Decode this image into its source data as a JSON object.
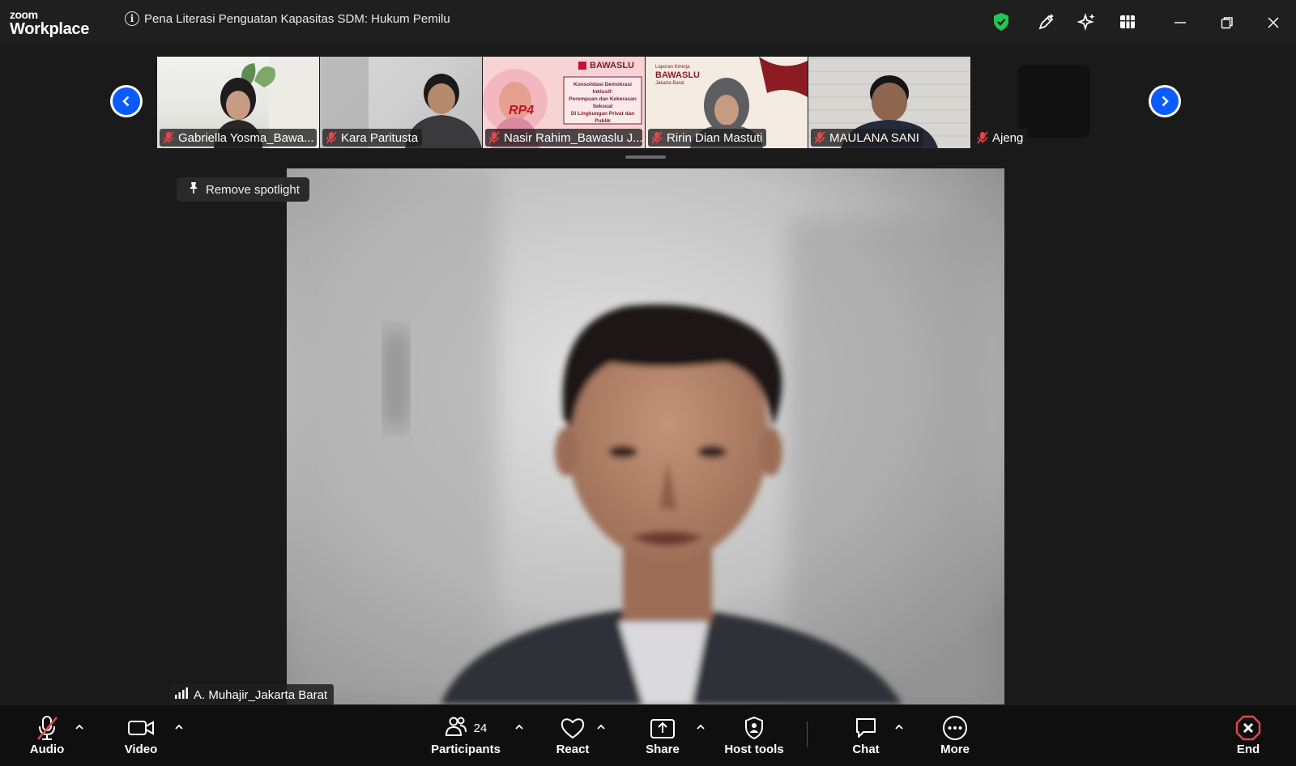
{
  "app": {
    "logo_line1": "zoom",
    "logo_line2": "Workplace"
  },
  "meeting": {
    "title": "Pena Literasi Penguatan Kapasitas SDM: Hukum Pemilu"
  },
  "colors": {
    "accent": "#0b5cff",
    "secure": "#23c552",
    "muted": "#e0484d",
    "end": "#e0484d"
  },
  "thumbnails": [
    {
      "name": "Gabriella Yosma_Bawa...",
      "muted": true
    },
    {
      "name": "Kara Paritusta",
      "muted": true
    },
    {
      "name": "Nasir Rahim_Bawaslu J...",
      "muted": true,
      "slide": {
        "brand": "BAWASLU",
        "line1": "Konsolidasi Demokrasi Inklusif:",
        "line2": "Perempuan dan Kekerasan Seksual",
        "line3": "Di Lingkungan Privat dan Publik",
        "badge": "RP4"
      }
    },
    {
      "name": "Ririn Dian Mastuti",
      "muted": true,
      "backdrop": {
        "top": "Laporan Kinerja",
        "brand": "BAWASLU",
        "sub": "Jakarta Barat"
      }
    },
    {
      "name": "MAULANA SANI",
      "muted": true
    },
    {
      "name": "Ajeng",
      "muted": true
    }
  ],
  "spotlight": {
    "label": "Remove spotlight"
  },
  "speaker": {
    "name": "A. Muhajir_Jakarta Barat"
  },
  "toolbar": {
    "audio": "Audio",
    "video": "Video",
    "participants": "Participants",
    "participants_count": "24",
    "react": "React",
    "share": "Share",
    "host_tools": "Host tools",
    "chat": "Chat",
    "more": "More",
    "end": "End"
  },
  "icons": [
    "info-icon",
    "shield-icon",
    "annotate-icon",
    "ai-sparkle-icon",
    "apps-icon",
    "minimize-icon",
    "restore-icon",
    "close-icon",
    "chevron-left-icon",
    "chevron-right-icon",
    "muted-mic-icon",
    "pin-icon",
    "signal-icon",
    "video-camera-icon",
    "participants-icon",
    "heart-icon",
    "share-icon",
    "host-shield-icon",
    "chat-icon",
    "more-icon",
    "end-icon"
  ]
}
